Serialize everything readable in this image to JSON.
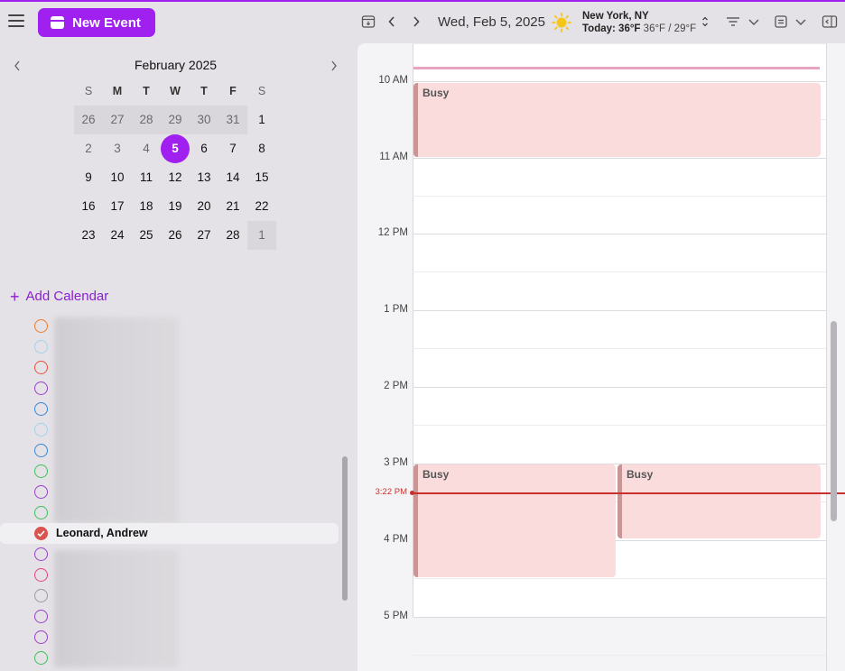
{
  "colors": {
    "accent": "#a020f0",
    "event_bg": "#fbdcdc",
    "event_bar": "#c99595",
    "now": "#c9302c"
  },
  "header": {
    "new_event_label": "New Event",
    "date_label": "Wed, Feb 5, 2025",
    "weather": {
      "city": "New York, NY",
      "today_prefix": "Today: ",
      "today_temp": "36°F",
      "range": "36°F / 29°F"
    },
    "icons": [
      "menu-icon",
      "calendar-icon",
      "today-icon",
      "chevron-left-icon",
      "chevron-right-icon",
      "sun-icon",
      "up-down-chevron-icon",
      "filter-icon",
      "chevron-down-icon",
      "view-icon",
      "chevron-down-icon",
      "split-view-icon"
    ]
  },
  "mini_calendar": {
    "month": "February 2025",
    "weekdays": [
      "S",
      "M",
      "T",
      "W",
      "T",
      "F",
      "S"
    ],
    "weeks": [
      [
        "26",
        "27",
        "28",
        "29",
        "30",
        "31",
        "1"
      ],
      [
        "2",
        "3",
        "4",
        "5",
        "6",
        "7",
        "8"
      ],
      [
        "9",
        "10",
        "11",
        "12",
        "13",
        "14",
        "15"
      ],
      [
        "16",
        "17",
        "18",
        "19",
        "20",
        "21",
        "22"
      ],
      [
        "23",
        "24",
        "25",
        "26",
        "27",
        "28",
        "1"
      ]
    ],
    "selected_day": "5"
  },
  "sidebar": {
    "add_calendar_label": "Add Calendar",
    "calendars": [
      {
        "color": "#f07a2a"
      },
      {
        "color": "#9fd3ea"
      },
      {
        "color": "#e5533f"
      },
      {
        "color": "#9b3fc7"
      },
      {
        "color": "#3a86d6"
      },
      {
        "color": "#9fd3ea"
      },
      {
        "color": "#3a86d6"
      },
      {
        "color": "#3fc15a"
      },
      {
        "color": "#9b3fc7"
      },
      {
        "color": "#3fc15a"
      },
      {
        "color": "#d9534f",
        "name": "Leonard, Andrew",
        "checked": true
      },
      {
        "color": "#9b3fc7"
      },
      {
        "color": "#e5457a"
      },
      {
        "color": "#9a9a9a"
      },
      {
        "color": "#9b3fc7"
      },
      {
        "color": "#9b3fc7"
      },
      {
        "color": "#3fc15a"
      }
    ]
  },
  "day_view": {
    "hours": [
      "10 AM",
      "11 AM",
      "12 PM",
      "1 PM",
      "2 PM",
      "3 PM",
      "4 PM",
      "5 PM"
    ],
    "now_label": "3:22 PM",
    "events": [
      {
        "title": "Busy"
      },
      {
        "title": "Busy"
      },
      {
        "title": "Busy"
      }
    ]
  }
}
